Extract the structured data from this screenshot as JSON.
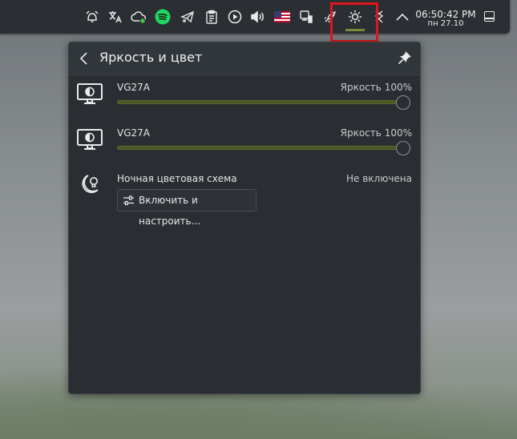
{
  "tray": {
    "icons": [
      "alarm-icon",
      "translate-icon",
      "cloud-sync-icon",
      "spotify-icon",
      "telegram-icon",
      "clipboard-icon",
      "media-player-icon",
      "volume-icon",
      "us-flag-keyboard-icon",
      "network-icon",
      "rocket-icon",
      "brightness-icon",
      "kde-connect-icon",
      "expand-tray-icon"
    ],
    "active": "brightness-icon",
    "clock": {
      "time": "06:50:42 PM",
      "date": "пн 27.10"
    }
  },
  "popup": {
    "title": "Яркость и цвет",
    "monitors": [
      {
        "name": "VG27A",
        "label": "Яркость",
        "percent": "100%",
        "level": 1.0
      },
      {
        "name": "VG27A",
        "label": "Яркость",
        "percent": "100%",
        "level": 1.0
      }
    ],
    "night": {
      "label": "Ночная цветовая схема",
      "status": "Не включена",
      "button": "Включить и настроить..."
    }
  },
  "colors": {
    "accent": "#7b8a3a",
    "highlight": "#e0171a",
    "panel": "#2b2e32"
  }
}
